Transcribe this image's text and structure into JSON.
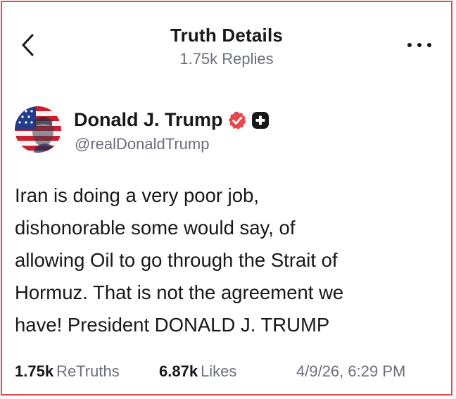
{
  "header": {
    "title": "Truth Details",
    "subtitle": "1.75k Replies",
    "back_icon": "chevron-left-icon",
    "more_icon": "more-horizontal-icon"
  },
  "post": {
    "author": {
      "name": "Donald J. Trump",
      "handle": "@realDonaldTrump",
      "avatar_icon": "avatar-flag-portrait"
    },
    "text_lines": [
      "Iran is doing a very poor job,",
      "dishonorable some would say, of",
      "allowing Oil to go through the Strait of",
      "Hormuz. That is not the agreement we",
      "have! President DONALD J. TRUMP"
    ],
    "stats": {
      "retruths_count": "1.75k",
      "retruths_label": "ReTruths",
      "likes_count": "6.87k",
      "likes_label": "Likes",
      "timestamp": "4/9/26, 6:29 PM"
    }
  },
  "colors": {
    "border": "#e8474d",
    "text_primary": "#17171c",
    "text_secondary": "#6b6e7b",
    "verified_badge": "#e8474d",
    "plus_badge": "#17171c"
  }
}
